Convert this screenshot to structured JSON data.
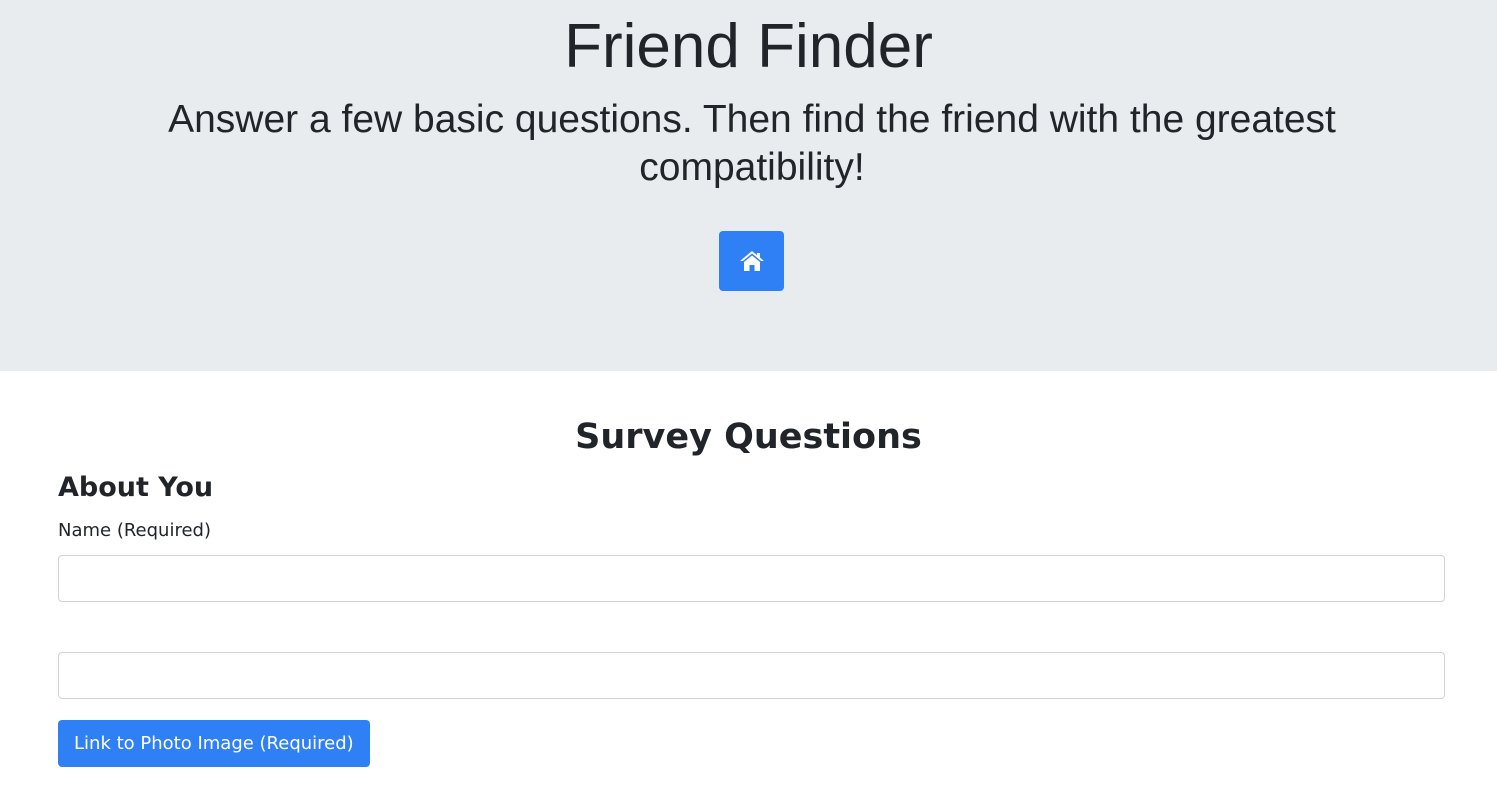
{
  "header": {
    "title": "Friend Finder",
    "tagline": "Answer a few basic questions. Then find the friend with the greatest compatibility!",
    "home_button": {
      "icon": "home-icon"
    }
  },
  "survey": {
    "title": "Survey Questions",
    "section": "About You",
    "name_label": "Name (Required)",
    "name_value": "",
    "photo_value": "",
    "photo_button_label": "Link to Photo Image (Required)"
  },
  "colors": {
    "header_background": "#e9ecef",
    "primary": "#2f80f5",
    "text": "#212529",
    "input_border": "#ced4da"
  }
}
